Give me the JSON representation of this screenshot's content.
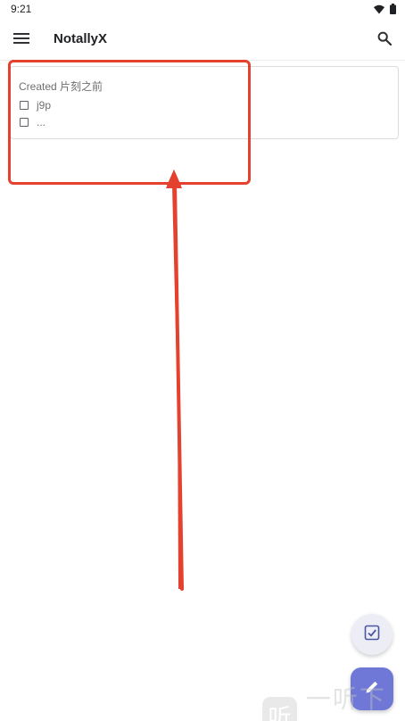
{
  "status_bar": {
    "time": "9:21",
    "icons": [
      "wifi-icon",
      "battery-icon"
    ]
  },
  "app_bar": {
    "title": "NotallyX",
    "menu_icon": "hamburger-menu-icon",
    "search_icon": "search-icon"
  },
  "note": {
    "title": "Created 片刻之前",
    "items": [
      {
        "text": "j9p",
        "checked": false
      },
      {
        "text": "...",
        "checked": false
      }
    ]
  },
  "fabs": {
    "checklist_icon": "checklist-icon",
    "edit_icon": "pencil-icon"
  },
  "watermark": {
    "badge": "听",
    "text": "一听下载"
  },
  "colors": {
    "accent": "#6f78d6",
    "annotation": "#e4412f",
    "fab_small_bg": "#edeef5"
  }
}
